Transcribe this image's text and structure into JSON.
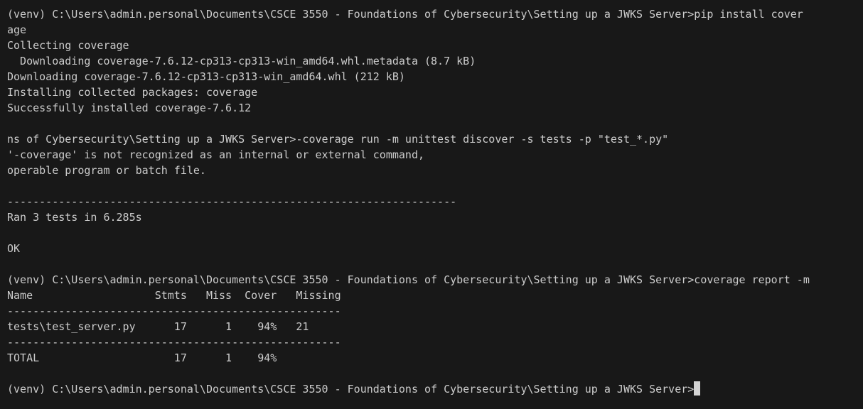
{
  "terminal": {
    "lines": [
      "(venv) C:\\Users\\admin.personal\\Documents\\CSCE 3550 - Foundations of Cybersecurity\\Setting up a JWKS Server>pip install cover",
      "age",
      "Collecting coverage",
      "  Downloading coverage-7.6.12-cp313-cp313-win_amd64.whl.metadata (8.7 kB)",
      "Downloading coverage-7.6.12-cp313-cp313-win_amd64.whl (212 kB)",
      "Installing collected packages: coverage",
      "Successfully installed coverage-7.6.12",
      "",
      "ns of Cybersecurity\\Setting up a JWKS Server>-coverage run -m unittest discover -s tests -p \"test_*.py\"",
      "'-coverage' is not recognized as an internal or external command,",
      "operable program or batch file.",
      "",
      "----------------------------------------------------------------------",
      "Ran 3 tests in 6.285s",
      "",
      "OK",
      "",
      "(venv) C:\\Users\\admin.personal\\Documents\\CSCE 3550 - Foundations of Cybersecurity\\Setting up a JWKS Server>coverage report -m",
      "Name                   Stmts   Miss  Cover   Missing",
      "----------------------------------------------------",
      "tests\\test_server.py      17      1    94%   21",
      "----------------------------------------------------",
      "TOTAL                     17      1    94%",
      ""
    ],
    "prompt": "(venv) C:\\Users\\admin.personal\\Documents\\CSCE 3550 - Foundations of Cybersecurity\\Setting up a JWKS Server>"
  },
  "colors": {
    "background": "#181818",
    "foreground": "#cccccc",
    "cursor": "#d4d4d4"
  }
}
